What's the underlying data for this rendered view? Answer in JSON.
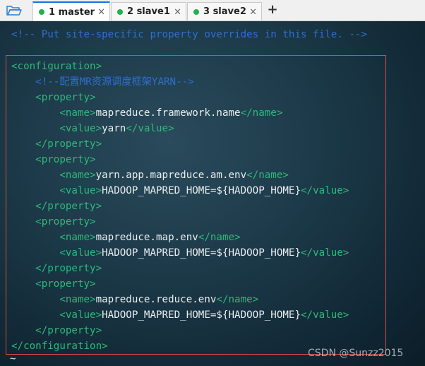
{
  "tabs": [
    {
      "label": "1 master",
      "close": "×",
      "dot_color": "#22b14c",
      "active": true
    },
    {
      "label": "2 slave1",
      "close": "×",
      "dot_color": "#22b14c",
      "active": false
    },
    {
      "label": "3 slave2",
      "close": "×",
      "dot_color": "#22b14c",
      "active": false
    }
  ],
  "add_tab_label": "+",
  "terminal": {
    "lines": [
      [
        {
          "t": "<!-- Put site-specific property overrides in this file. -->",
          "c": "comment"
        }
      ],
      [
        {
          "t": "<configuration>",
          "c": "tag"
        }
      ],
      [
        {
          "t": "    <!--配置MR资源调度框架YARN-->",
          "c": "comment"
        }
      ],
      [
        {
          "t": "    <property>",
          "c": "tag"
        }
      ],
      [
        {
          "t": "        <name>",
          "c": "tag"
        },
        {
          "t": "mapreduce.framework.name",
          "c": "text"
        },
        {
          "t": "</name>",
          "c": "tag"
        }
      ],
      [
        {
          "t": "        <value>",
          "c": "tag"
        },
        {
          "t": "yarn",
          "c": "text"
        },
        {
          "t": "</value>",
          "c": "tag"
        }
      ],
      [
        {
          "t": "    </property>",
          "c": "tag"
        }
      ],
      [
        {
          "t": "    <property>",
          "c": "tag"
        }
      ],
      [
        {
          "t": "        <name>",
          "c": "tag"
        },
        {
          "t": "yarn.app.mapreduce.am.env",
          "c": "text"
        },
        {
          "t": "</name>",
          "c": "tag"
        }
      ],
      [
        {
          "t": "        <value>",
          "c": "tag"
        },
        {
          "t": "HADOOP_MAPRED_HOME=${HADOOP_HOME}",
          "c": "text"
        },
        {
          "t": "</value>",
          "c": "tag"
        }
      ],
      [
        {
          "t": "    </property>",
          "c": "tag"
        }
      ],
      [
        {
          "t": "    <property>",
          "c": "tag"
        }
      ],
      [
        {
          "t": "        <name>",
          "c": "tag"
        },
        {
          "t": "mapreduce.map.env",
          "c": "text"
        },
        {
          "t": "</name>",
          "c": "tag"
        }
      ],
      [
        {
          "t": "        <value>",
          "c": "tag"
        },
        {
          "t": "HADOOP_MAPRED_HOME=${HADOOP_HOME}",
          "c": "text"
        },
        {
          "t": "</value>",
          "c": "tag"
        }
      ],
      [
        {
          "t": "    </property>",
          "c": "tag"
        }
      ],
      [
        {
          "t": "    <property>",
          "c": "tag"
        }
      ],
      [
        {
          "t": "        <name>",
          "c": "tag"
        },
        {
          "t": "mapreduce.reduce.env",
          "c": "text"
        },
        {
          "t": "</name>",
          "c": "tag"
        }
      ],
      [
        {
          "t": "        <value>",
          "c": "tag"
        },
        {
          "t": "HADOOP_MAPRED_HOME=${HADOOP_HOME}",
          "c": "text"
        },
        {
          "t": "</value>",
          "c": "tag"
        }
      ],
      [
        {
          "t": "    </property>",
          "c": "tag"
        }
      ],
      [
        {
          "t": "</configuration>",
          "c": "tag"
        }
      ]
    ],
    "tilde": "~",
    "watermark": "CSDN @Sunzz2015"
  }
}
